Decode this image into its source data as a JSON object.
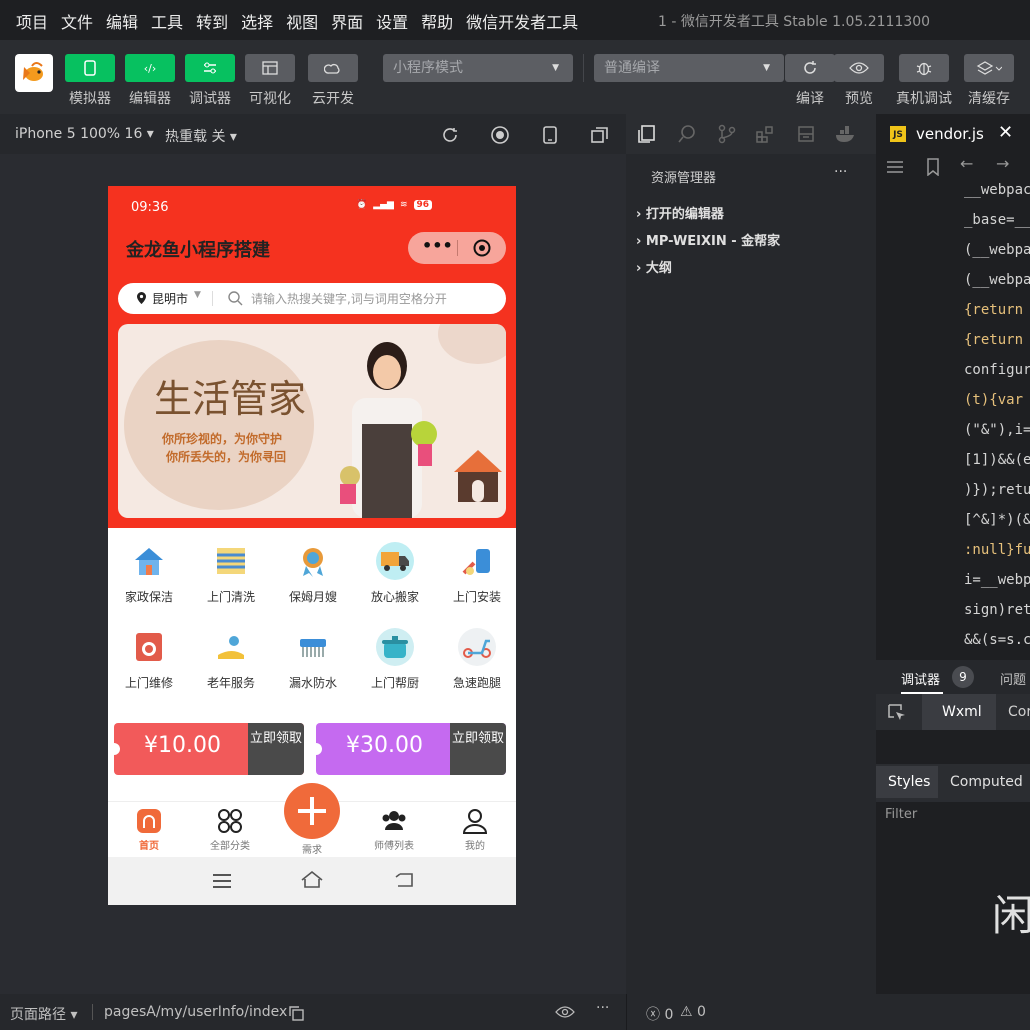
{
  "menu": [
    "项目",
    "文件",
    "编辑",
    "工具",
    "转到",
    "选择",
    "视图",
    "界面",
    "设置",
    "帮助",
    "微信开发者工具"
  ],
  "window_title": "1 - 微信开发者工具 Stable 1.05.2111300",
  "toolbar": {
    "simulator": "模拟器",
    "editor": "编辑器",
    "debugger": "调试器",
    "visual": "可视化",
    "cloud": "云开发",
    "mode": "小程序模式",
    "compile": "普通编译",
    "compile_btn": "编译",
    "preview": "预览",
    "remote_debug": "真机调试",
    "clear_cache": "清缓存"
  },
  "simbar": {
    "device": "iPhone 5 100% 16",
    "hot_reload": "热重载 关"
  },
  "phone": {
    "time": "09:36",
    "battery": "96",
    "app_title": "金龙鱼小程序搭建",
    "city": "昆明市",
    "search_placeholder": "请输入热搜关键字,词与词用空格分开",
    "banner_title": "生活管家",
    "banner_line1": "你所珍视的，为你守护",
    "banner_line2": "你所丢失的，为你寻回",
    "categories": [
      "家政保洁",
      "上门清洗",
      "保姆月嫂",
      "放心搬家",
      "上门安装",
      "上门维修",
      "老年服务",
      "漏水防水",
      "上门帮厨",
      "急速跑腿"
    ],
    "coupons": [
      {
        "amount": "¥10.00",
        "claim": "立即领取",
        "color": "#f25a5a"
      },
      {
        "amount": "¥30.00",
        "claim": "立即领取",
        "color": "#c56af0"
      }
    ],
    "tabs": [
      "首页",
      "全部分类",
      "需求",
      "师傅列表",
      "我的"
    ],
    "accent": "#f5321f",
    "tab_active": "#f06a3a"
  },
  "explorer": {
    "title": "资源管理器",
    "more": "···",
    "items": [
      "打开的编辑器",
      "MP-WEIXIN - 金帮家",
      "大纲"
    ]
  },
  "editor": {
    "tab": "vendor.js",
    "lines": [
      "__webpac",
      "_base=__",
      "(__webpa",
      "(__webpa",
      "{return ",
      "{return ",
      "configur",
      "(t){var ",
      "(\"&\"),i=",
      "[1])&&(e",
      ")});retu",
      "[^&]*)(&",
      ":null}fu",
      "i=__webp",
      "sign)ret",
      "&&(s=s.c"
    ]
  },
  "devtools": {
    "tab_debugger": "调试器",
    "badge": "9",
    "tab_issues": "问题",
    "wxml": "Wxml",
    "console_short": "Cor",
    "styles": "Styles",
    "computed": "Computed",
    "filter_placeholder": "Filter",
    "idle_char": "闲"
  },
  "status": {
    "path_label": "页面路径",
    "path": "pagesA/my/userInfo/index",
    "errors": "0",
    "warnings": "0"
  }
}
